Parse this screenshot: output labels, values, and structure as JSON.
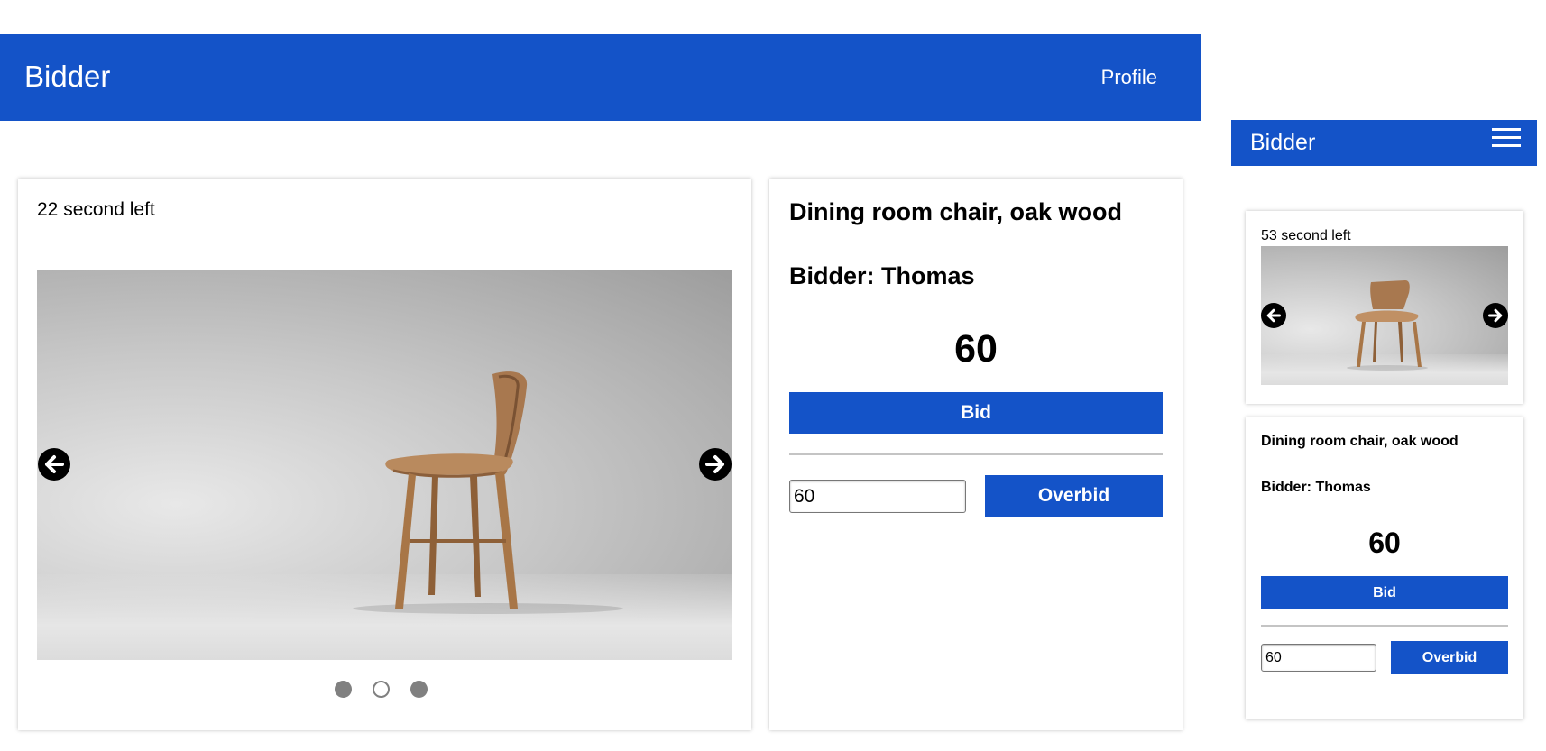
{
  "desktop": {
    "header": {
      "brand": "Bidder",
      "profile_link": "Profile"
    },
    "gallery": {
      "timer": "22 second left",
      "prev_icon": "arrow-left-icon",
      "next_icon": "arrow-right-icon",
      "image": "chair-photo",
      "dots": [
        {
          "active": false
        },
        {
          "active": true
        },
        {
          "active": false
        }
      ]
    },
    "details": {
      "item_title": "Dining room chair, oak wood",
      "bidder": "Bidder: Thomas",
      "current_bid": "60",
      "bid_label": "Bid",
      "overbid_value": "60",
      "overbid_label": "Overbid"
    }
  },
  "mobile": {
    "header": {
      "brand": "Bidder",
      "menu_icon": "hamburger-icon"
    },
    "gallery": {
      "timer": "53 second left",
      "image": "chair-photo"
    },
    "details": {
      "item_title": "Dining room chair, oak wood",
      "bidder": "Bidder: Thomas",
      "current_bid": "60",
      "bid_label": "Bid",
      "overbid_value": "60",
      "overbid_label": "Overbid"
    }
  },
  "colors": {
    "primary": "#1453c8",
    "dot": "#808080",
    "divider": "#c4c4c4"
  }
}
